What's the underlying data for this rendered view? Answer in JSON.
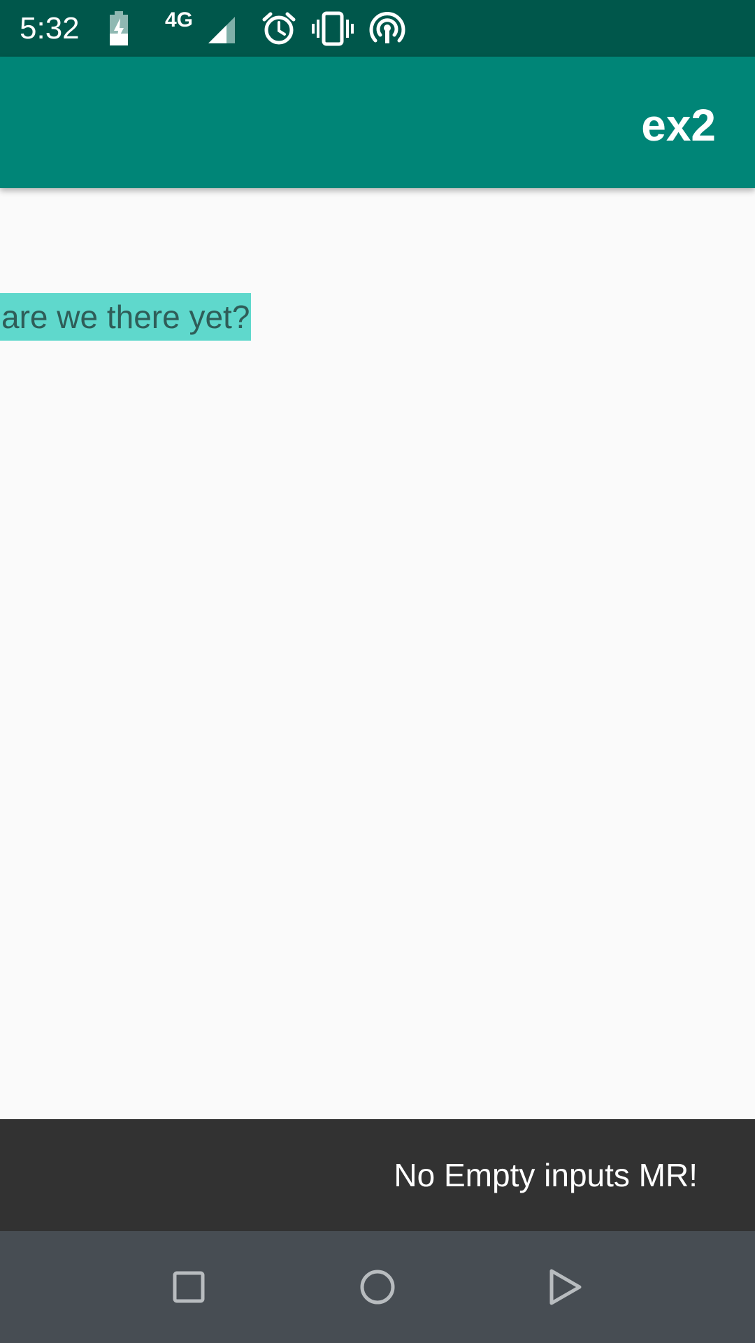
{
  "status_bar": {
    "time": "5:32",
    "network_label": "4G",
    "icons": [
      "battery-charging-icon",
      "signal-icon",
      "alarm-icon",
      "vibrate-icon",
      "hotspot-icon"
    ],
    "background": "#00574b"
  },
  "app_bar": {
    "title": "ex2",
    "background": "#008577"
  },
  "content": {
    "highlighted_text": "are we there yet?",
    "highlight_color": "#5fd8cc"
  },
  "snackbar": {
    "message": "No Empty inputs MR!",
    "background": "#323232"
  },
  "nav_bar": {
    "buttons": [
      "recents-icon",
      "home-icon",
      "back-icon"
    ],
    "background": "#474d53"
  }
}
